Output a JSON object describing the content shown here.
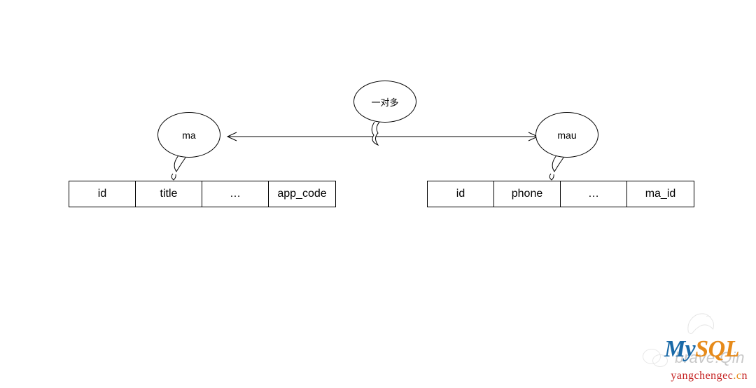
{
  "diagram": {
    "relationship_label": "一对多",
    "entities": {
      "left": {
        "name": "ma",
        "columns": [
          "id",
          "title",
          "…",
          "app_code"
        ]
      },
      "right": {
        "name": "mau",
        "columns": [
          "id",
          "phone",
          "…",
          "ma_id"
        ]
      }
    },
    "arrow": {
      "type": "open-diamond-both-ends",
      "from": "ma",
      "to": "mau"
    }
  },
  "watermarks": {
    "brave_text": "brave.Qin",
    "logo_text_my": "My",
    "logo_text_sql": "SQL",
    "url_colored": [
      {
        "t": "y",
        "c": "#c42020"
      },
      {
        "t": "a",
        "c": "#c42020"
      },
      {
        "t": "n",
        "c": "#c42020"
      },
      {
        "t": "g",
        "c": "#c42020"
      },
      {
        "t": "c",
        "c": "#c42020"
      },
      {
        "t": "h",
        "c": "#c42020"
      },
      {
        "t": "e",
        "c": "#c42020"
      },
      {
        "t": "n",
        "c": "#c42020"
      },
      {
        "t": "g",
        "c": "#c42020"
      },
      {
        "t": "e",
        "c": "#c42020"
      },
      {
        "t": "c",
        "c": "#c42020"
      },
      {
        "t": ".",
        "c": "#e68a1a"
      },
      {
        "t": "c",
        "c": "#e68a1a"
      },
      {
        "t": "n",
        "c": "#c42020"
      }
    ]
  }
}
